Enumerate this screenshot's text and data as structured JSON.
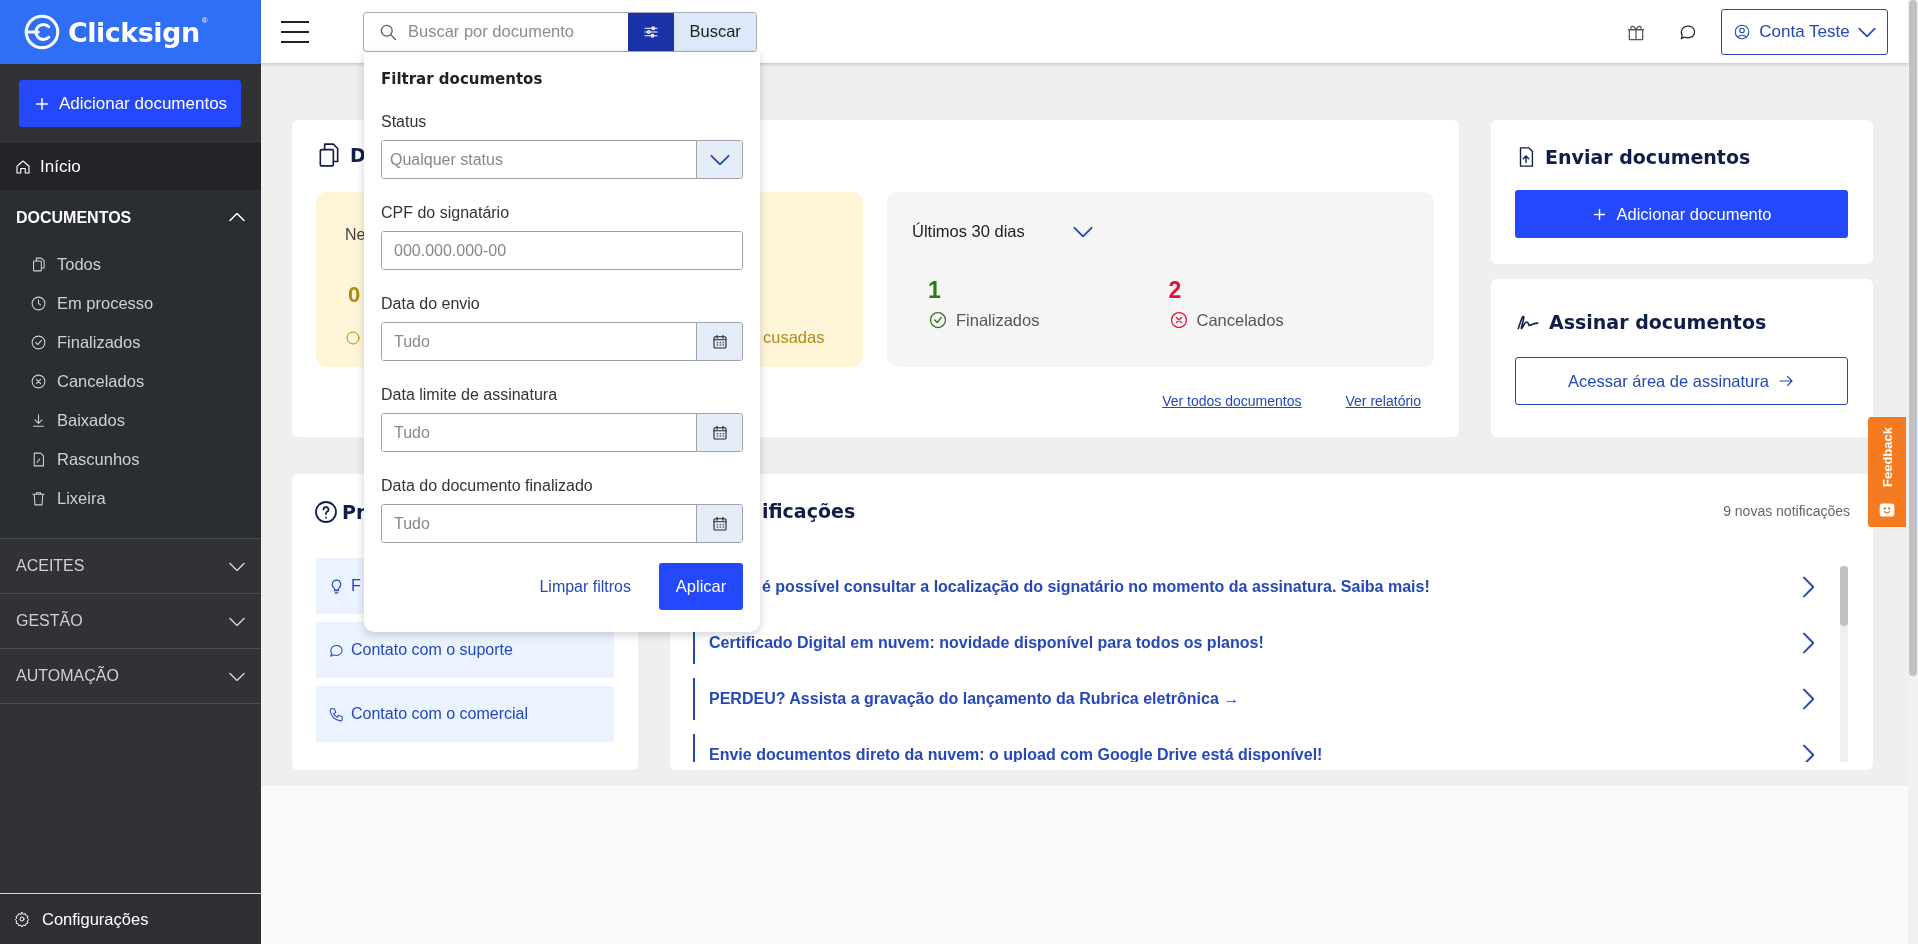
{
  "brand": {
    "name": "Clicksign",
    "mark": "®"
  },
  "sidebar": {
    "add_button": "Adicionar documentos",
    "home": {
      "label": "Início",
      "selected": true
    },
    "sections": [
      {
        "label": "DOCUMENTOS",
        "expanded": true,
        "items": [
          {
            "label": "Todos"
          },
          {
            "label": "Em processo"
          },
          {
            "label": "Finalizados"
          },
          {
            "label": "Cancelados"
          },
          {
            "label": "Baixados"
          },
          {
            "label": "Rascunhos"
          },
          {
            "label": "Lixeira"
          }
        ]
      },
      {
        "label": "ACEITES",
        "expanded": false
      },
      {
        "label": "GESTÃO",
        "expanded": false
      },
      {
        "label": "AUTOMAÇÃO",
        "expanded": false
      }
    ],
    "footer": "Configurações"
  },
  "topbar": {
    "search_placeholder": "Buscar por documento",
    "filter_active": true,
    "search_button": "Buscar",
    "account": "Conta Teste"
  },
  "filter_panel": {
    "title": "Filtrar documentos",
    "fields": [
      {
        "kind": "select",
        "label": "Status",
        "placeholder": "Qualquer status"
      },
      {
        "kind": "text",
        "label": "CPF do signatário",
        "placeholder": "000.000.000-00"
      },
      {
        "kind": "date",
        "label": "Data do envio",
        "placeholder": "Tudo"
      },
      {
        "kind": "date",
        "label": "Data limite de assinatura",
        "placeholder": "Tudo"
      },
      {
        "kind": "date",
        "label": "Data do documento finalizado",
        "placeholder": "Tudo"
      }
    ],
    "clear": "Limpar filtros",
    "apply": "Aplicar"
  },
  "documents_card": {
    "title": "D",
    "pending": {
      "label": "Ne",
      "count": "0",
      "status": "cusadas"
    },
    "period": "Últimos 30 dias",
    "stats": [
      {
        "kind": "done",
        "value": "1",
        "label": "Finalizados"
      },
      {
        "kind": "canceled",
        "value": "2",
        "label": "Cancelados"
      }
    ],
    "links": [
      "Ver todos documentos",
      "Ver relatório"
    ]
  },
  "send_card": {
    "title": "Enviar documentos",
    "button": "Adicionar documento"
  },
  "sign_card": {
    "title": "Assinar documentos",
    "button": "Acessar área de assinatura"
  },
  "help_card": {
    "title": "Pr",
    "items": [
      "F",
      "Contato com o suporte",
      "Contato com o comercial"
    ]
  },
  "notifications": {
    "title": "ificações",
    "count": "9 novas notificações",
    "items": [
      "é possível consultar a localização do signatário no momento da assinatura. Saiba mais!",
      "Certificado Digital em nuvem: novidade disponível para todos os planos!",
      "PERDEU? Assista a gravação do lançamento da Rubrica eletrônica →",
      "Envie documentos direto da nuvem: o upload com Google Drive está disponível!"
    ]
  },
  "feedback": "Feedback"
}
